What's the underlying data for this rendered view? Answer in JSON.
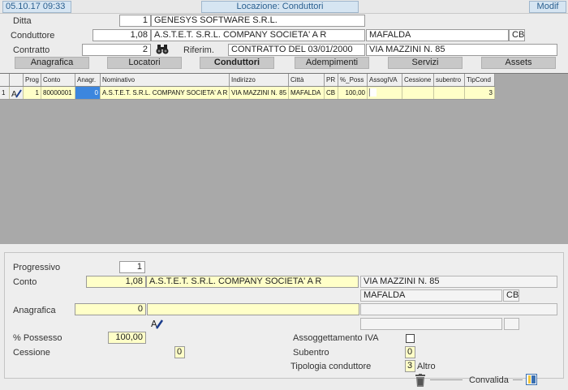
{
  "header": {
    "datetime": "05.10.17 09:33",
    "title": "Locazione: Conduttori",
    "mode": "Modif"
  },
  "top_form": {
    "ditta_label": "Ditta",
    "ditta_code": "1",
    "ditta_name": "GENESYS SOFTWARE S.R.L.",
    "conduttore_label": "Conduttore",
    "conduttore_code": "1,08",
    "conduttore_name": "A.S.T.E.T. S.R.L. COMPANY SOCIETA' A R",
    "conduttore_city": "MAFALDA",
    "conduttore_prov": "CB",
    "contratto_label": "Contratto",
    "contratto_code": "2",
    "riferim_label": "Riferim.",
    "riferim_value": "CONTRATTO DEL 03/01/2000",
    "riferim_address": "VIA MAZZINI N. 85",
    "binoculars_icon": "binoculars-icon"
  },
  "tabs": [
    {
      "label": "Anagrafica"
    },
    {
      "label": "Locatori"
    },
    {
      "label": "Conduttori"
    },
    {
      "label": "Adempimenti"
    },
    {
      "label": "Servizi"
    },
    {
      "label": "Assets"
    }
  ],
  "grid": {
    "columns": [
      "Prog",
      "Conto",
      "Anagr.",
      "Nominativo",
      "Indirizzo",
      "Città",
      "PR",
      "%_Poss",
      "AssogIVA",
      "Cessione",
      "subentro",
      "TipCond"
    ],
    "rows": [
      {
        "num": "1",
        "prog": "1",
        "conto": "80000001",
        "anagr": "0",
        "nominativo": "A.S.T.E.T. S.R.L. COMPANY SOCIETA' A R",
        "indirizzo": "VIA MAZZINI N. 85",
        "citta": "MAFALDA",
        "pr": "CB",
        "poss": "100,00",
        "assogiva": "",
        "cessione": "",
        "subentro": "",
        "tipcond": "3"
      }
    ]
  },
  "detail": {
    "progressivo_label": "Progressivo",
    "progressivo_value": "1",
    "conto_label": "Conto",
    "conto_code": "1,08",
    "conto_name": "A.S.T.E.T. S.R.L. COMPANY SOCIETA' A R",
    "conto_address": "VIA MAZZINI N. 85",
    "conto_city": "MAFALDA",
    "conto_prov": "CB",
    "anagrafica_label": "Anagrafica",
    "anagrafica_code": "0",
    "possesso_label": "% Possesso",
    "possesso_value": "100,00",
    "cessione_label": "Cessione",
    "cessione_value": "0",
    "assogg_label": "Assoggettamento IVA",
    "subentro_label": "Subentro",
    "subentro_value": "0",
    "tipologia_label": "Tipologia conduttore",
    "tipologia_value": "3",
    "tipologia_desc": "Altro",
    "convalida_label": "Convalida"
  }
}
